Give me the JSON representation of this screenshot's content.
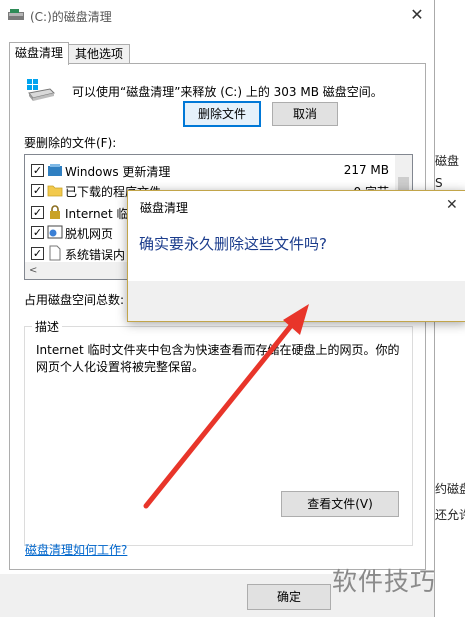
{
  "window": {
    "title": "(C:)的磁盘清理",
    "close_glyph": "✕"
  },
  "tabs": [
    {
      "label": "磁盘清理"
    },
    {
      "label": "其他选项"
    }
  ],
  "intro": "可以使用“磁盘清理”来释放 (C:) 上的 303 MB 磁盘空间。",
  "files_label": "要删除的文件(F):",
  "files": [
    {
      "name": "Windows 更新清理",
      "size": "217 MB",
      "checked": true
    },
    {
      "name": "已下载的程序文件",
      "size": "0 字节",
      "checked": true
    },
    {
      "name": "Internet 临",
      "size": "",
      "checked": true
    },
    {
      "name": "脱机网页",
      "size": "",
      "checked": true
    },
    {
      "name": "系统错误内",
      "size": "",
      "checked": true
    }
  ],
  "space_label": "占用磁盘空间总数:",
  "description": {
    "legend": "描述",
    "text": "Internet 临时文件夹中包含为快速查看而存储在硬盘上的网页。你的网页个人化设置将被完整保留。"
  },
  "view_files_button": "查看文件(V)",
  "help_link": "磁盘清理如何工作?",
  "ok_button": "确定",
  "watermark": "软件技巧",
  "background_window": {
    "fragments": [
      "磁盘",
      "S",
      "约磁盘",
      "还允许"
    ]
  },
  "dialog": {
    "title": "磁盘清理",
    "close_glyph": "✕",
    "question": "确实要永久删除这些文件吗?",
    "delete_button": "删除文件",
    "cancel_button": "取消"
  },
  "colors": {
    "accent": "#0078d7",
    "arrow": "#e8352a",
    "link": "#0066cc",
    "question": "#1b3c8c"
  },
  "icons": [
    "disk-cleanup-icon",
    "drive-icon",
    "windows-update-icon",
    "folder-icon",
    "lock-icon",
    "globe-page-icon",
    "document-icon"
  ]
}
